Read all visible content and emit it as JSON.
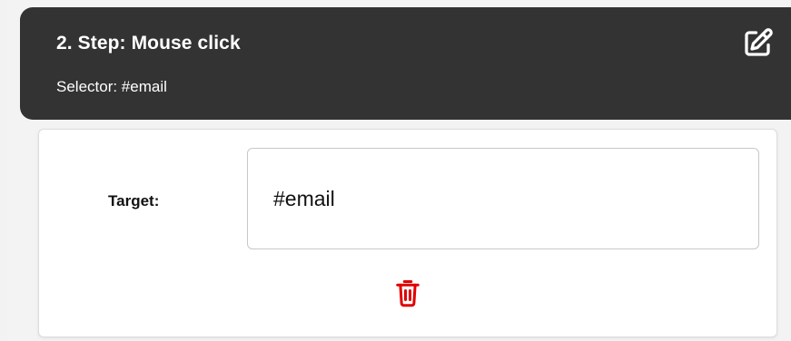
{
  "step": {
    "title": "2. Step: Mouse click",
    "subtitle": "Selector: #email",
    "edit_icon": "edit-pencil-icon"
  },
  "form": {
    "target_label": "Target:",
    "target_value": "#email",
    "delete_icon": "trash-icon"
  },
  "colors": {
    "header_bg": "#333333",
    "header_text": "#ffffff",
    "panel_bg": "#f3f3f3",
    "delete_red": "#e00000"
  }
}
